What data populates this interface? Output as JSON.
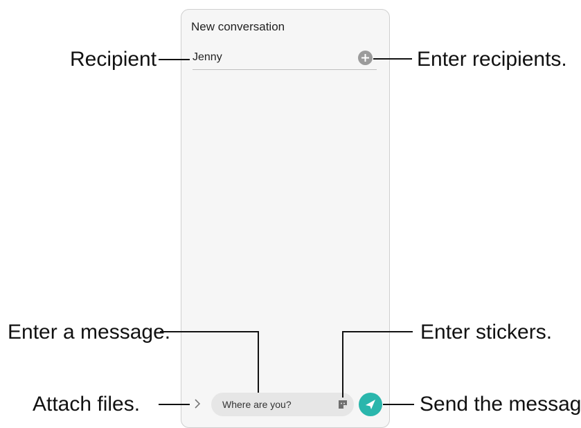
{
  "screen": {
    "title": "New conversation",
    "recipient_value": "Jenny",
    "message_input": "Where are you?"
  },
  "callouts": {
    "recipient": "Recipient",
    "enter_recipients": "Enter recipients.",
    "enter_message": "Enter a message.",
    "enter_stickers": "Enter stickers.",
    "attach_files": "Attach files.",
    "send_message": "Send the message."
  },
  "icons": {
    "add_recipient": "plus-circle-icon",
    "attach": "chevron-right-icon",
    "sticker": "sticker-icon",
    "send": "paper-plane-icon"
  },
  "colors": {
    "send_button": "#2ab6ac",
    "add_button": "#9b9b9b",
    "input_background": "#e6e6e6",
    "screen_background": "#f6f6f6"
  }
}
